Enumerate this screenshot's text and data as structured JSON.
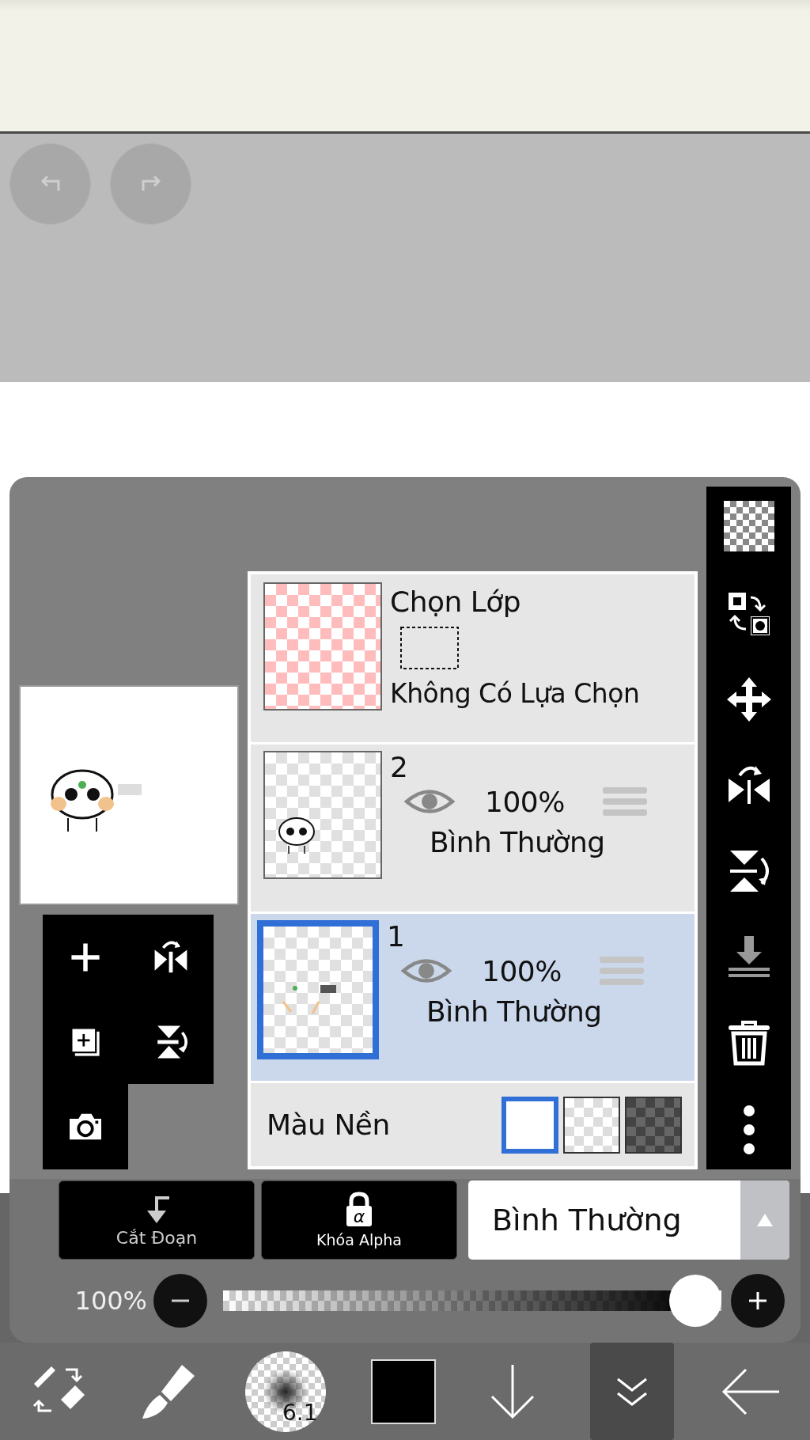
{
  "selection_layer": {
    "title": "Chọn Lớp",
    "status": "Không Có Lựa Chọn"
  },
  "layers": [
    {
      "name": "2",
      "visible": true,
      "opacity": "100%",
      "blend_mode": "Bình Thường",
      "selected": false
    },
    {
      "name": "1",
      "visible": true,
      "opacity": "100%",
      "blend_mode": "Bình Thường",
      "selected": true
    }
  ],
  "background_color": {
    "label": "Màu Nền",
    "options": [
      {
        "kind": "white",
        "selected": true
      },
      {
        "kind": "transparent",
        "selected": false
      },
      {
        "kind": "dark",
        "selected": false
      }
    ]
  },
  "actions": [
    {
      "kind": "clip",
      "label": "Cắt Đoạn"
    },
    {
      "kind": "alpha",
      "label": "Khóa Alpha",
      "glyph": "α"
    }
  ],
  "blend_mode": {
    "value": "Bình Thường"
  },
  "opacity": {
    "reading": "100%",
    "level": 1
  },
  "brush": {
    "size": "6.1"
  }
}
